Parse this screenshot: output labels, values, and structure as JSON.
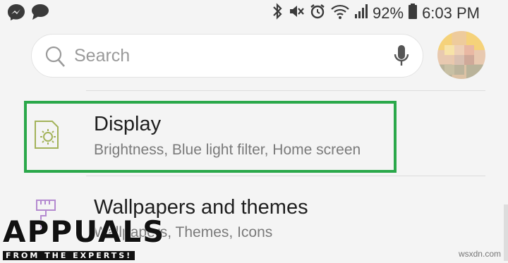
{
  "status_bar": {
    "battery": "92%",
    "time": "6:03 PM"
  },
  "search": {
    "placeholder": "Search"
  },
  "items": [
    {
      "title": "Display",
      "subtitle": "Brightness, Blue light filter, Home screen"
    },
    {
      "title": "Wallpapers and themes",
      "subtitle": "Wallpapers, Themes, Icons"
    }
  ],
  "watermark": {
    "logo": "APPUALS",
    "tagline": "FROM THE EXPERTS!",
    "site": "wsxdn.com"
  },
  "colors": {
    "highlight": "#2aa84a",
    "display_icon": "#a3b35a",
    "wallpaper_icon": "#b48ad0"
  }
}
